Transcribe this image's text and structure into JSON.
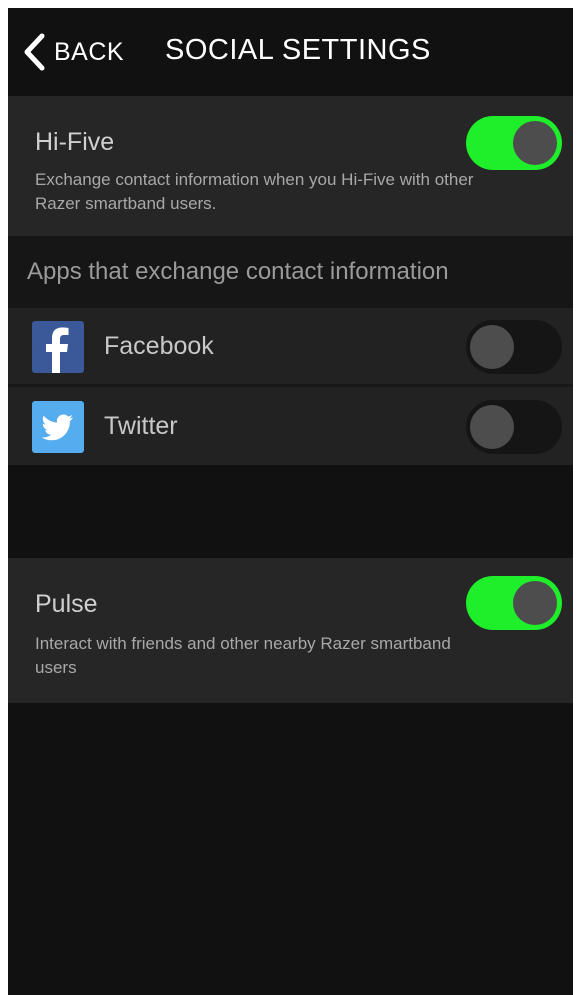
{
  "header": {
    "back_label": "BACK",
    "title": "SOCIAL SETTINGS"
  },
  "hifive": {
    "title": "Hi-Five",
    "description": "Exchange contact information when you Hi-Five with other Razer smartband users.",
    "enabled": true
  },
  "apps_section": {
    "header": "Apps that exchange contact information",
    "items": [
      {
        "label": "Facebook",
        "icon": "facebook-icon",
        "enabled": false
      },
      {
        "label": "Twitter",
        "icon": "twitter-icon",
        "enabled": false
      }
    ]
  },
  "pulse": {
    "title": "Pulse",
    "description": "Interact with friends and other nearby Razer smartband users",
    "enabled": true
  },
  "colors": {
    "toggle_on": "#1eef2a",
    "background": "#111111",
    "row_background": "#262626",
    "facebook": "#3b5998",
    "twitter": "#55acee"
  }
}
